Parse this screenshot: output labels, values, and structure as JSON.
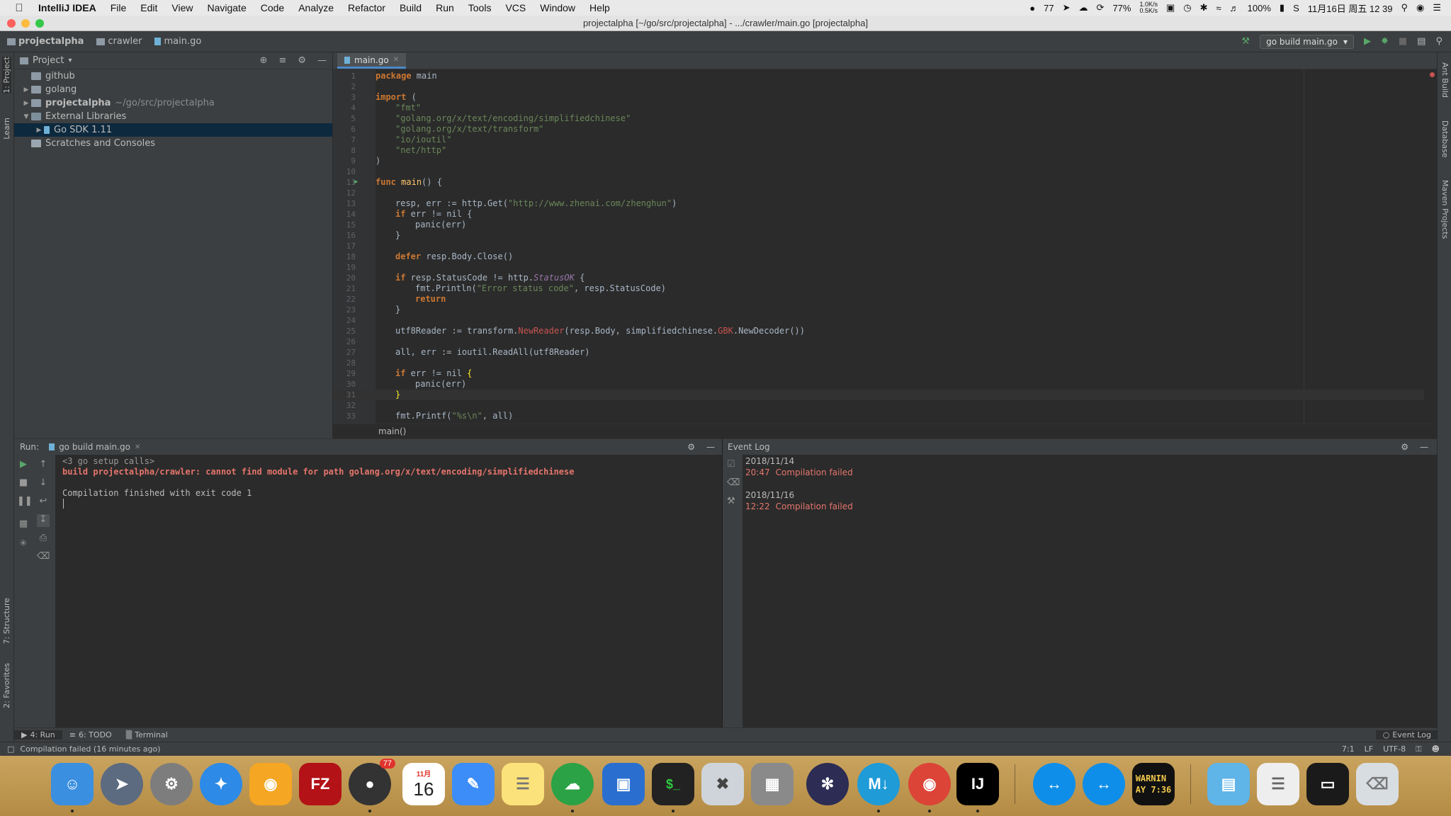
{
  "menubar": {
    "app_name": "IntelliJ IDEA",
    "items": [
      "File",
      "Edit",
      "View",
      "Navigate",
      "Code",
      "Analyze",
      "Refactor",
      "Build",
      "Run",
      "Tools",
      "VCS",
      "Window",
      "Help"
    ],
    "status": {
      "qq_count": "77",
      "battery_label": "77%",
      "net_up": "1.0K/s",
      "net_down": "0.5K/s",
      "battery_percent": "100%",
      "datetime": "11月16日 周五 12 39"
    }
  },
  "window": {
    "title": "projectalpha [~/go/src/projectalpha] - .../crawler/main.go [projectalpha]"
  },
  "navbar": {
    "crumbs": [
      "projectalpha",
      "crawler",
      "main.go"
    ],
    "run_config": "go build main.go"
  },
  "left_strip": {
    "tabs": [
      "1: Project",
      "Learn",
      "7: Structure",
      "2: Favorites"
    ]
  },
  "right_strip": {
    "tabs": [
      "Ant Build",
      "Database",
      "Maven Projects"
    ]
  },
  "project_panel": {
    "title": "Project",
    "tree": [
      {
        "label": "github",
        "extra": ""
      },
      {
        "label": "golang",
        "extra": ""
      },
      {
        "label": "projectalpha",
        "extra": "~/go/src/projectalpha"
      },
      {
        "label": "External Libraries",
        "extra": ""
      },
      {
        "label": "Go SDK 1.11",
        "extra": ""
      },
      {
        "label": "Scratches and Consoles",
        "extra": ""
      }
    ]
  },
  "editor": {
    "tab_label": "main.go",
    "breadcrumb": "main()",
    "line_numbers": [
      "1",
      "2",
      "3",
      "4",
      "5",
      "6",
      "7",
      "8",
      "9",
      "10",
      "11",
      "12",
      "13",
      "14",
      "15",
      "16",
      "17",
      "18",
      "19",
      "20",
      "21",
      "22",
      "23",
      "24",
      "25",
      "26",
      "27",
      "28",
      "29",
      "30",
      "31",
      "32",
      "33"
    ],
    "code": {
      "l1_kw": "package",
      "l1_rest": " main",
      "l3_kw": "import",
      "l3_rest": " (",
      "l4": "\"fmt\"",
      "l5": "\"golang.org/x/text/encoding/simplifiedchinese\"",
      "l6": "\"golang.org/x/text/transform\"",
      "l7": "\"io/ioutil\"",
      "l8": "\"net/http\"",
      "l9": ")",
      "l11_kw": "func",
      "l11_fn": "main",
      "l11_rest": "() {",
      "l13_a": "resp, err := http.Get(",
      "l13_str": "\"http://www.zhenai.com/zhenghun\"",
      "l13_b": ")",
      "l14_kw": "if",
      "l14_rest": " err != nil {",
      "l15": "panic(err)",
      "l16": "}",
      "l18_kw": "defer",
      "l18_rest": " resp.Body.Close()",
      "l20_kw": "if",
      "l20_a": " resp.StatusCode != http.",
      "l20_it": "StatusOK",
      "l20_b": " {",
      "l21_a": "fmt.Println(",
      "l21_str": "\"Error status code\"",
      "l21_b": ", resp.StatusCode)",
      "l22_kw": "return",
      "l23": "}",
      "l25_a": "utf8Reader := transform.",
      "l25_err1": "NewReader",
      "l25_b": "(resp.Body, simplifiedchinese.",
      "l25_err2": "GBK",
      "l25_c": ".NewDecoder())",
      "l27": "all, err := ioutil.ReadAll(utf8Reader)",
      "l29_kw": "if",
      "l29_rest": " err != nil ",
      "l29_brace": "{",
      "l30": "panic(err)",
      "l31": "}",
      "l33_a": "fmt.Printf(",
      "l33_str": "\"%s\\n\"",
      "l33_b": ", all)"
    }
  },
  "run_panel": {
    "label": "Run:",
    "tab": "go build main.go",
    "console": {
      "setup": "<3 go setup calls>",
      "error": "build projectalpha/crawler: cannot find module for path golang.org/x/text/encoding/simplifiedchinese",
      "finished": "Compilation finished with exit code 1"
    }
  },
  "event_log": {
    "title": "Event Log",
    "entries": [
      {
        "date": "2018/11/14",
        "time": "20:47",
        "message": "Compilation failed"
      },
      {
        "date": "2018/11/16",
        "time": "12:22",
        "message": "Compilation failed"
      }
    ]
  },
  "tool_bar": {
    "run": "4: Run",
    "todo": "6: TODO",
    "terminal": "Terminal",
    "event_log": "Event Log"
  },
  "status_bar": {
    "message": "Compilation failed (16 minutes ago)",
    "position": "7:1",
    "line_sep": "LF",
    "encoding": "UTF-8"
  },
  "dock": {
    "calendar_month": "11月",
    "calendar_day": "16",
    "qq_badge": "77",
    "console_text": "WARNIN\nAY 7:36"
  },
  "colors": {
    "editor_bg": "#2b2b2b",
    "panel_bg": "#3c3f41",
    "keyword": "#cc7832",
    "string": "#6a8759",
    "error": "#e5756c",
    "function": "#ffc66d"
  }
}
